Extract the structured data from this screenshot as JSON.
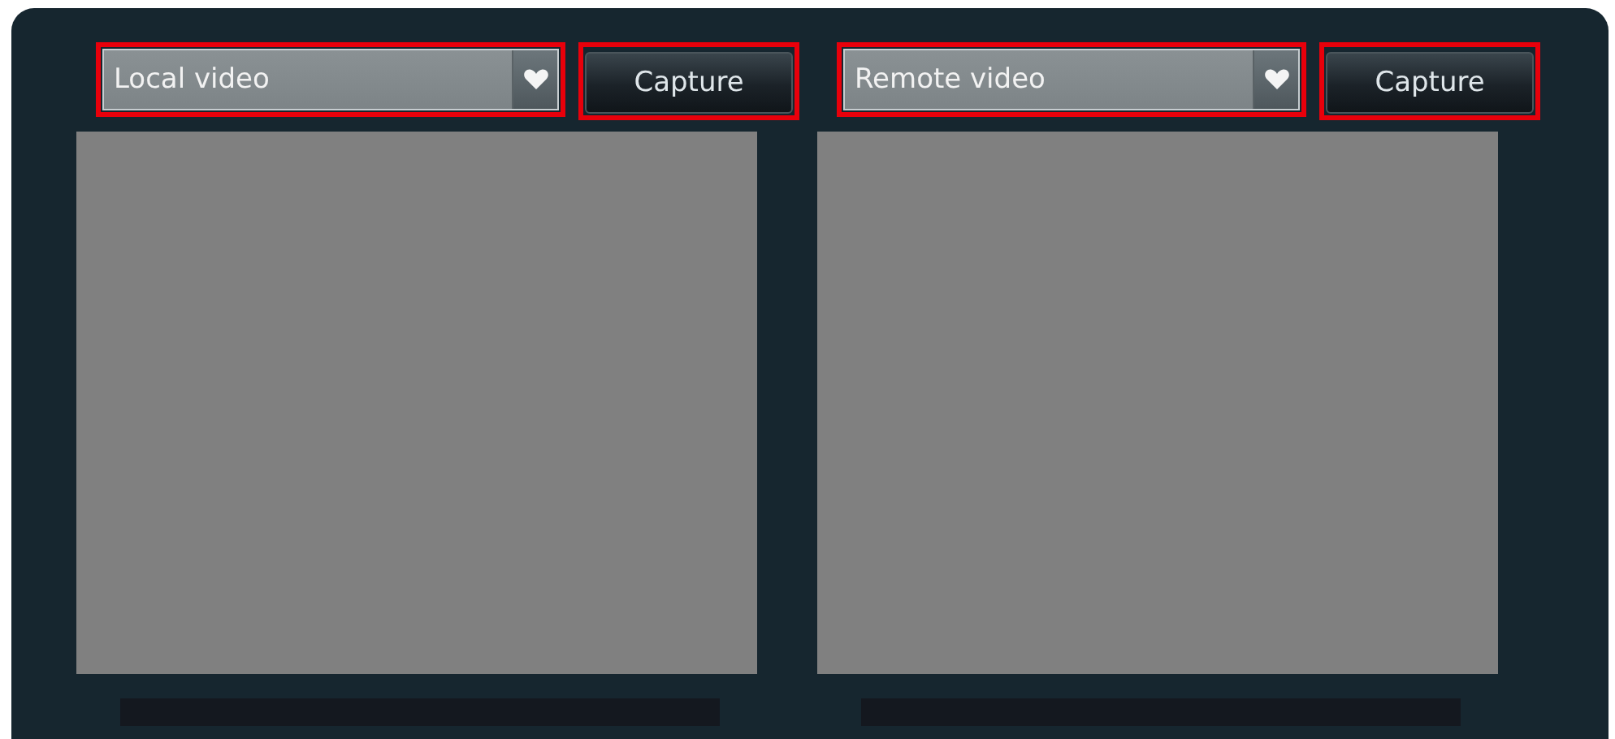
{
  "panes": [
    {
      "source": {
        "value": "Local video",
        "highlighted": true
      },
      "capture": {
        "label": "Capture",
        "highlighted": true
      }
    },
    {
      "source": {
        "value": "Remote video",
        "highlighted": true
      },
      "capture": {
        "label": "Capture",
        "highlighted": true
      }
    }
  ]
}
